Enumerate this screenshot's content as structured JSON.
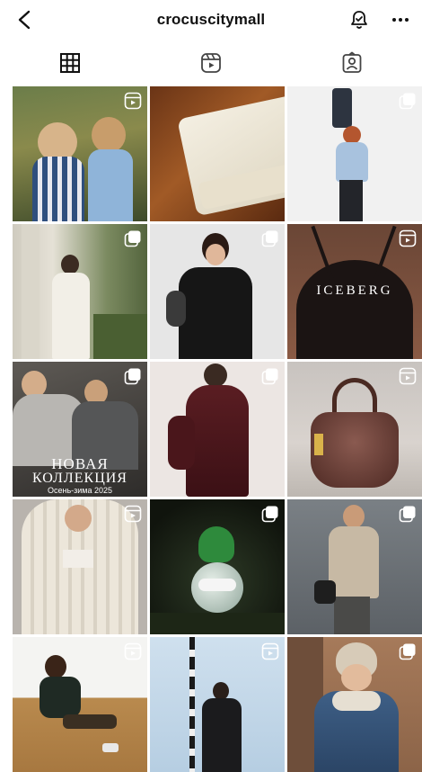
{
  "header": {
    "title": "crocuscitymall",
    "icons": [
      "back-chevron-icon",
      "notification-bell-icon",
      "more-options-icon"
    ]
  },
  "tabs": [
    {
      "name": "posts-grid",
      "icon": "grid-icon",
      "active": true
    },
    {
      "name": "reels",
      "icon": "reels-icon",
      "active": false
    },
    {
      "name": "tagged",
      "icon": "tagged-person-icon",
      "active": false
    }
  ],
  "posts": [
    {
      "id": "p1",
      "type": "reel"
    },
    {
      "id": "p2",
      "type": "none"
    },
    {
      "id": "p3",
      "type": "carousel"
    },
    {
      "id": "p4",
      "type": "carousel"
    },
    {
      "id": "p5",
      "type": "carousel"
    },
    {
      "id": "p6",
      "type": "reel",
      "text": "ICEBERG"
    },
    {
      "id": "p7",
      "type": "carousel",
      "text_line1": "НОВАЯ",
      "text_line2": "КОЛЛЕКЦИЯ",
      "text_line3": "Осень-зима 2025"
    },
    {
      "id": "p8",
      "type": "carousel"
    },
    {
      "id": "p9",
      "type": "reel"
    },
    {
      "id": "p10",
      "type": "reel"
    },
    {
      "id": "p11",
      "type": "carousel"
    },
    {
      "id": "p12",
      "type": "carousel"
    },
    {
      "id": "p13",
      "type": "reel"
    },
    {
      "id": "p14",
      "type": "reel"
    },
    {
      "id": "p15",
      "type": "carousel"
    }
  ],
  "colors": {
    "background": "#ffffff",
    "text": "#111111"
  }
}
